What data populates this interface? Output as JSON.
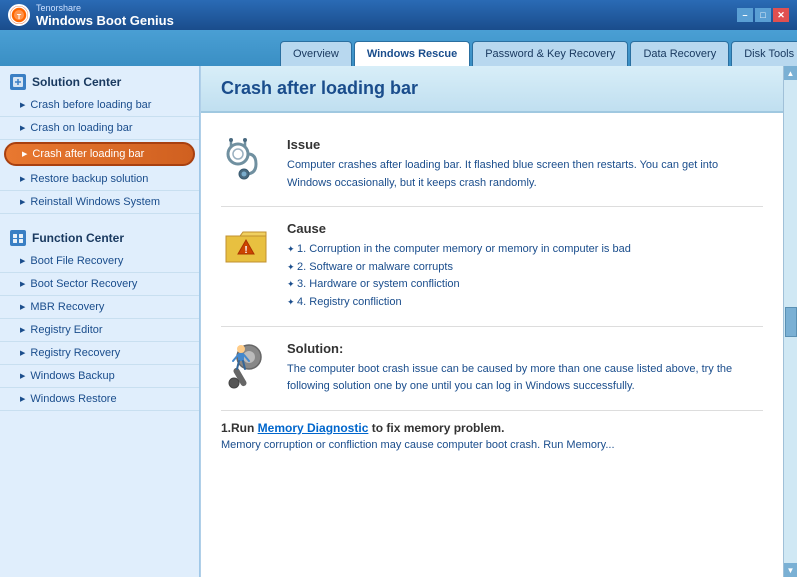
{
  "titlebar": {
    "brand": "Tenorshare",
    "app_name": "Windows Boot Genius",
    "controls": {
      "minimize": "–",
      "maximize": "□",
      "close": "✕"
    }
  },
  "nav": {
    "tabs": [
      {
        "id": "overview",
        "label": "Overview",
        "active": false
      },
      {
        "id": "windows-rescue",
        "label": "Windows Rescue",
        "active": true
      },
      {
        "id": "password-recovery",
        "label": "Password & Key Recovery",
        "active": false
      },
      {
        "id": "data-recovery",
        "label": "Data Recovery",
        "active": false
      },
      {
        "id": "disk-tools",
        "label": "Disk Tools",
        "active": false
      }
    ]
  },
  "sidebar": {
    "solution_center": {
      "header": "Solution Center",
      "items": [
        {
          "id": "crash-before",
          "label": "Crash before loading bar",
          "active": false
        },
        {
          "id": "crash-on",
          "label": "Crash on loading bar",
          "active": false
        },
        {
          "id": "crash-after",
          "label": "Crash after loading bar",
          "active": true
        },
        {
          "id": "restore-backup",
          "label": "Restore backup solution",
          "active": false
        },
        {
          "id": "reinstall-windows",
          "label": "Reinstall Windows System",
          "active": false
        }
      ]
    },
    "function_center": {
      "header": "Function Center",
      "items": [
        {
          "id": "boot-file",
          "label": "Boot File Recovery",
          "active": false
        },
        {
          "id": "boot-sector",
          "label": "Boot Sector Recovery",
          "active": false
        },
        {
          "id": "mbr-recovery",
          "label": "MBR Recovery",
          "active": false
        },
        {
          "id": "registry-editor",
          "label": "Registry Editor",
          "active": false
        },
        {
          "id": "registry-recovery",
          "label": "Registry Recovery",
          "active": false
        },
        {
          "id": "windows-backup",
          "label": "Windows Backup",
          "active": false
        },
        {
          "id": "windows-restore",
          "label": "Windows Restore",
          "active": false
        }
      ]
    }
  },
  "content": {
    "title": "Crash after loading bar",
    "issue": {
      "heading": "Issue",
      "text": "Computer crashes after loading bar. It flashed blue screen then restarts. You can get into Windows occasionally, but it keeps crash randomly."
    },
    "cause": {
      "heading": "Cause",
      "items": [
        "1. Corruption in the computer memory or memory in computer is bad",
        "2. Software or malware corrupts",
        "3. Hardware or system confliction",
        "4. Registry confliction"
      ]
    },
    "solution": {
      "heading": "Solution:",
      "text": "The computer boot crash issue can be caused by more than one cause listed above, try the following solution one by one until you can log in Windows successfully."
    },
    "step1": {
      "prefix": "1.Run ",
      "link": "Memory Diagnostic",
      "suffix": " to fix memory problem."
    }
  }
}
